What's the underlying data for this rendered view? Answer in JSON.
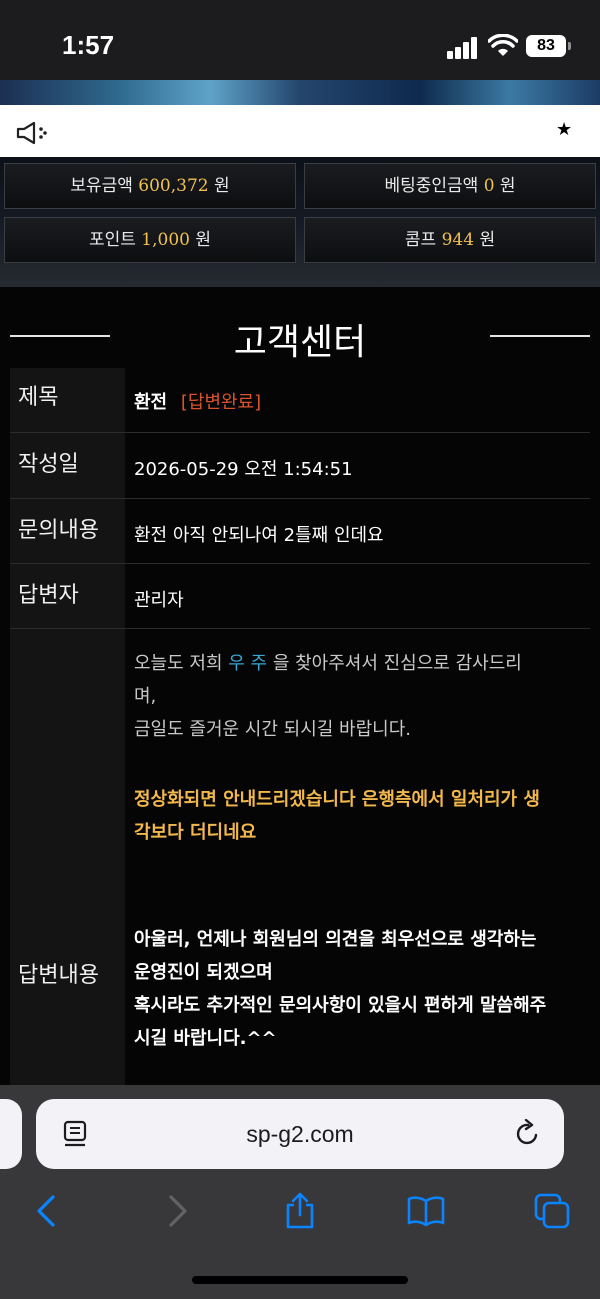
{
  "status_bar": {
    "time": "1:57",
    "battery": "83"
  },
  "notice": {
    "text": "★"
  },
  "wallet": {
    "balance_label": "보유금액",
    "balance_value": "600,372",
    "balance_unit": "원",
    "betting_label": "베팅중인금액",
    "betting_value": "0",
    "betting_unit": "원",
    "point_label": "포인트",
    "point_value": "1,000",
    "point_unit": "원",
    "comp_label": "콤프",
    "comp_value": "944",
    "comp_unit": "원"
  },
  "page": {
    "title": "고객센터"
  },
  "inquiry": {
    "subject_label": "제목",
    "subject_value": "환전",
    "subject_status": "[답변완료]",
    "date_label": "작성일",
    "date_value": "2026-05-29 오전 1:54:51",
    "content_label": "문의내용",
    "content_value": "환전 아직 안되나여 2틀째 인데요",
    "responder_label": "답변자",
    "responder_value": "관리자",
    "answer_label": "답변내용",
    "answer": {
      "greeting_pre": "오늘도 저희 ",
      "greeting_brand": "우 주",
      "greeting_post": " 을 찾아주셔서 진심으로 감사드리",
      "greeting_post2": "며,",
      "greeting_line2": "금일도 즐거운 시간 되시길 바랍니다.",
      "main_line1": "정상화되면 안내드리겠습니다 은행측에서 일처리가 생",
      "main_line2": "각보다 더디네요",
      "closing_line1": "아울러, 언제나 회원님의 의견을 최우선으로 생각하는",
      "closing_line2": "운영진이 되겠으며",
      "closing_line3": "혹시라도 추가적인 문의사항이 있을시 편하게 말씀해주",
      "closing_line4": "시길 바랍니다.^^"
    }
  },
  "browser": {
    "url": "sp-g2.com"
  },
  "colors": {
    "accent_gold": "#f2c14e",
    "status_red": "#d9542c",
    "brand_blue": "#39a9d6",
    "safari_blue": "#0a84ff"
  }
}
